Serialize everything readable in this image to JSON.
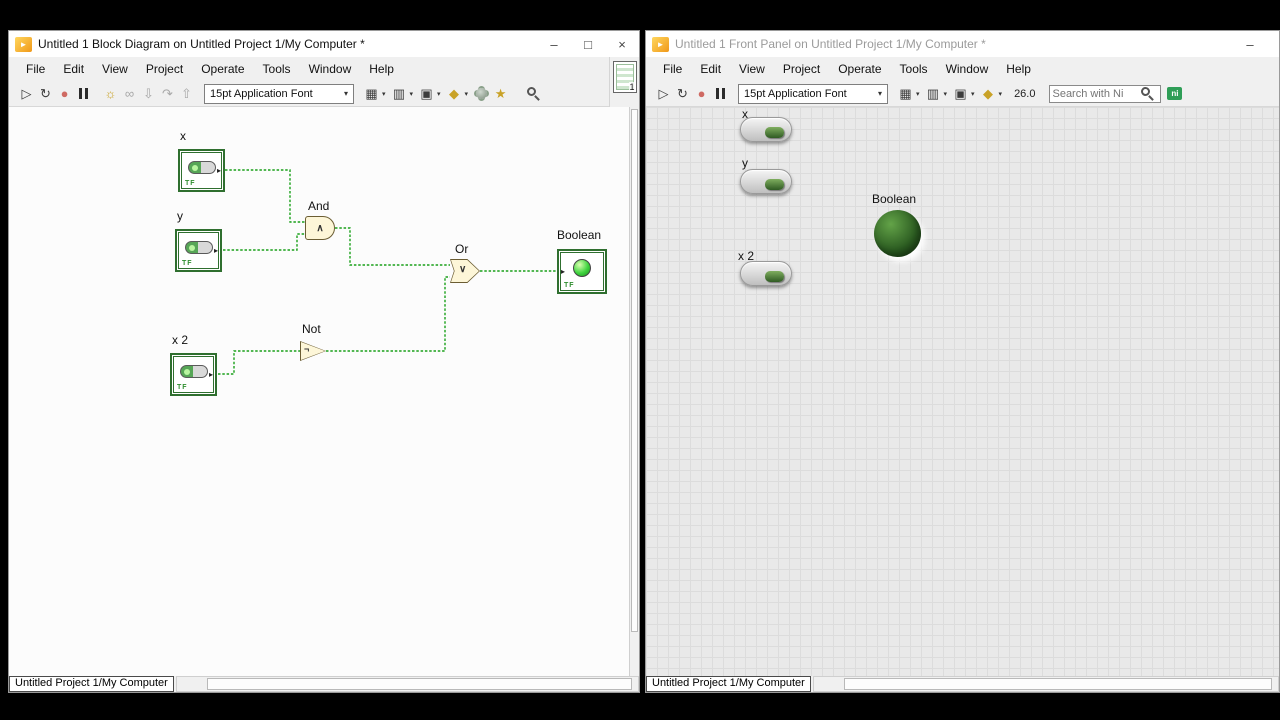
{
  "icons": {
    "labview_logo": "►",
    "run": "▷",
    "run_continuous": "↻",
    "abort": "●",
    "highlight_execution": "☼",
    "retain_wire_values": "∞",
    "step_into": "⇩",
    "step_over": "↷",
    "step_out": "⇧",
    "align_objects": "▦",
    "distribute_objects": "▥",
    "resize_objects": "▣",
    "reorder": "◆",
    "cleanup": "★",
    "caret": "▾",
    "terminal_arrow": "▸",
    "minimize": "–",
    "maximize": "□",
    "close": "×",
    "ni_logo": "ni"
  },
  "colors": {
    "wire_green": "#1aa01a",
    "terminal_green": "#2f6f2f",
    "gate_cream": "#fdf6d8"
  },
  "left_window": {
    "title": "Untitled 1 Block Diagram on Untitled Project 1/My Computer *",
    "menu": [
      "File",
      "Edit",
      "View",
      "Project",
      "Operate",
      "Tools",
      "Window",
      "Help"
    ],
    "toolbar": {
      "font_selector": "15pt Application Font"
    },
    "vi_icon_number": "1",
    "status_bar": "Untitled Project 1/My Computer",
    "diagram": {
      "controls": [
        {
          "label": "x",
          "terminal": "TF"
        },
        {
          "label": "y",
          "terminal": "TF"
        },
        {
          "label": "x 2",
          "terminal": "TF"
        }
      ],
      "gates": [
        {
          "label": "And",
          "glyph": "∧"
        },
        {
          "label": "Or",
          "glyph": "∨"
        },
        {
          "label": "Not",
          "glyph": "¬"
        }
      ],
      "indicator": {
        "label": "Boolean",
        "terminal": "TF"
      }
    }
  },
  "right_window": {
    "title": "Untitled 1 Front Panel on Untitled Project 1/My Computer *",
    "menu": [
      "File",
      "Edit",
      "View",
      "Project",
      "Operate",
      "Tools",
      "Window",
      "Help"
    ],
    "toolbar": {
      "font_selector": "15pt Application Font",
      "zoom_level": "26.0",
      "search_placeholder": "Search with Ni"
    },
    "status_bar": "Untitled Project 1/My Computer",
    "panel": {
      "controls": [
        {
          "label": "x"
        },
        {
          "label": "y"
        },
        {
          "label": "x 2"
        }
      ],
      "indicator": {
        "label": "Boolean"
      }
    }
  }
}
